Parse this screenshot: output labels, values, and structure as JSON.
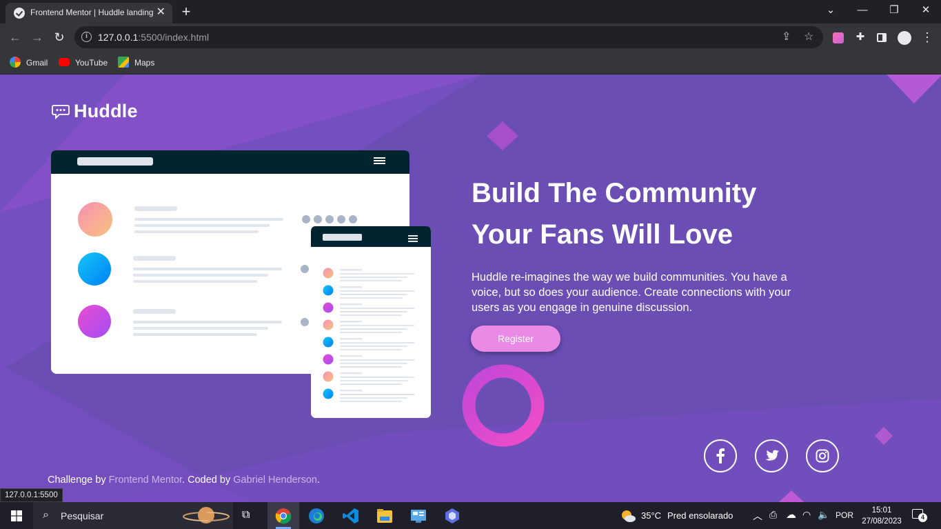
{
  "browser": {
    "tab_title": "Frontend Mentor | Huddle landing page",
    "new_tab_label": "+",
    "url_host": "127.0.0.1",
    "url_rest": ":5500/index.html",
    "bookmarks": [
      {
        "label": "Gmail",
        "color": "#ea4335"
      },
      {
        "label": "YouTube",
        "color": "#ff0000"
      },
      {
        "label": "Maps",
        "color": "#34a853"
      }
    ],
    "status_url": "127.0.0.1:5500"
  },
  "page": {
    "logo_text": "Huddle",
    "headline_line1": "Build The Community",
    "headline_line2": "Your Fans Will Love",
    "description": "Huddle re-imagines the way we build communities. You have a voice, but so does your audience. Create connections with your users as you engage in genuine discussion.",
    "register_label": "Register",
    "social_icons": [
      "facebook-icon",
      "twitter-icon",
      "instagram-icon"
    ],
    "footer": {
      "prefix": "Challenge by ",
      "link1": "Frontend Mentor",
      "middle": ". Coded by ",
      "link2": "Gabriel Henderson",
      "suffix": "."
    },
    "colors": {
      "background": "#6a4eb4",
      "button": "#e98ae6",
      "mockup_header": "#00252e"
    }
  },
  "taskbar": {
    "search_placeholder": "Pesquisar",
    "weather_temp": "35°C",
    "weather_text": "Pred ensolarado",
    "language": "POR",
    "time": "15:01",
    "date": "27/08/2023",
    "notification_count": "4"
  }
}
